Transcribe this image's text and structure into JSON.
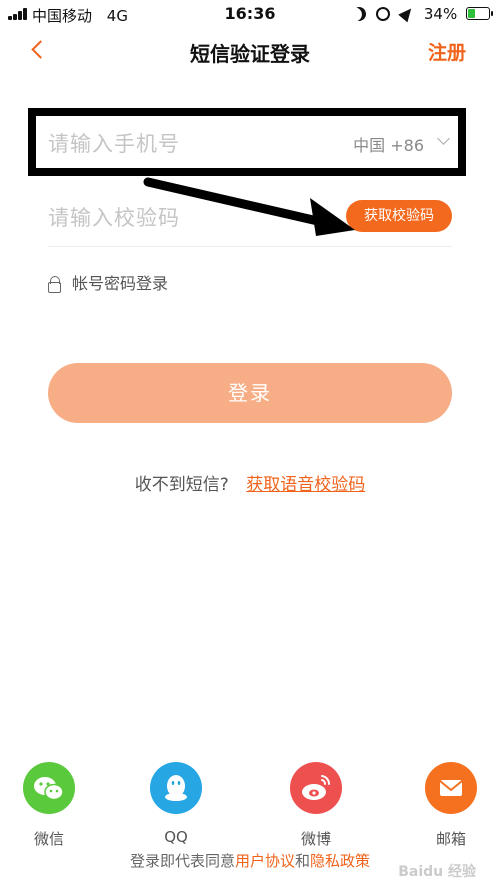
{
  "status_bar": {
    "carrier": "中国移动",
    "network": "4G",
    "time": "16:36",
    "battery_percent": "34%"
  },
  "nav": {
    "title": "短信验证登录",
    "register_label": "注册"
  },
  "form": {
    "phone_placeholder": "请输入手机号",
    "country_code": "中国 +86",
    "code_placeholder": "请输入校验码",
    "get_code_label": "获取校验码",
    "password_login_label": "帐号密码登录",
    "login_button_label": "登录"
  },
  "no_sms": {
    "text": "收不到短信?",
    "voice_link": "获取语音校验码"
  },
  "social": [
    {
      "label": "微信",
      "icon": "wechat-icon"
    },
    {
      "label": "QQ",
      "icon": "qq-icon"
    },
    {
      "label": "微博",
      "icon": "weibo-icon"
    },
    {
      "label": "邮箱",
      "icon": "mail-icon"
    }
  ],
  "agreement": {
    "prefix": "登录即代表同意",
    "user_agreement": "用户协议",
    "and": "和",
    "privacy_policy": "隐私政策"
  },
  "watermark": "Baidu 经验",
  "colors": {
    "accent": "#f0631b",
    "login_button": "#f7ae86",
    "wechat": "#5ac93b",
    "qq": "#27a6e4",
    "weibo": "#ee4f4f",
    "mail": "#f5711f"
  }
}
